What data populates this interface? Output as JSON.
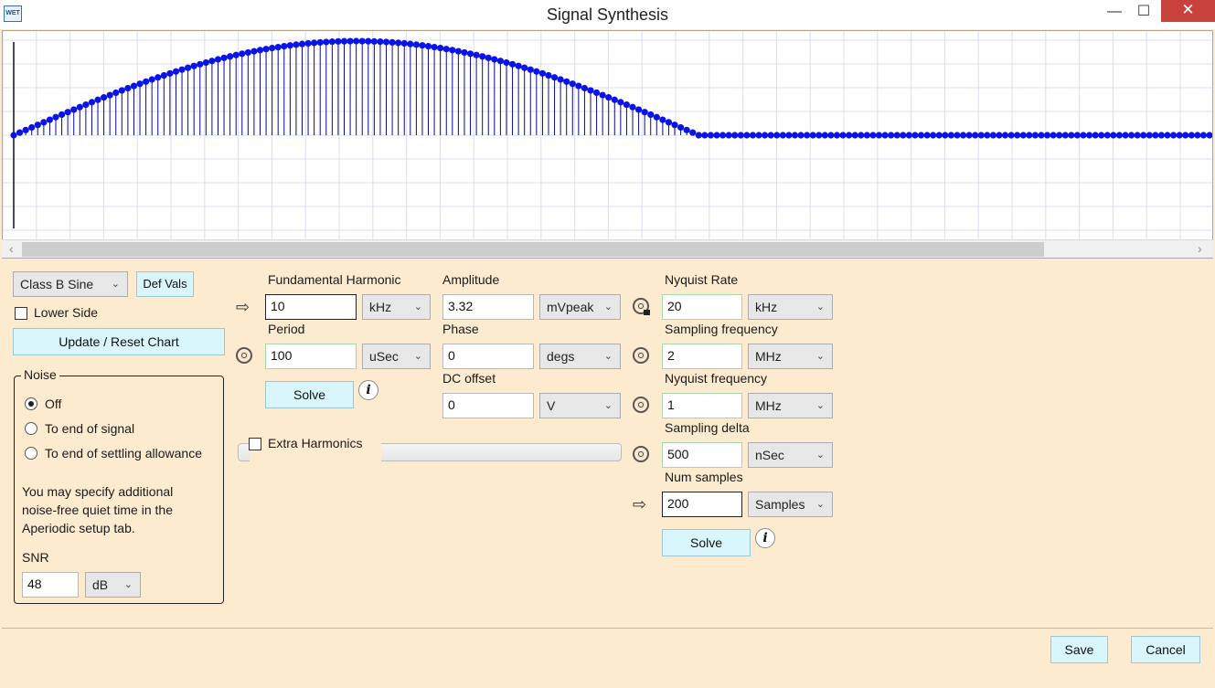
{
  "window": {
    "title": "Signal Synthesis",
    "app_icon_text": "WET"
  },
  "chart_data": {
    "type": "stem",
    "num_samples": 200,
    "description_values": "half-sine (Class B) lobe over first 114 samples then zero",
    "lobe_samples": 114,
    "amplitude": 1,
    "series": [
      {
        "values": "generated: samples 0..113 = sin(pi*n/114), samples 114..199 = 0"
      }
    ],
    "grid": true,
    "marker_color": "#0a14e8",
    "stem_color": "#0a0a8a"
  },
  "waveform": {
    "selected": "Class B Sine",
    "def_vals_label": "Def Vals",
    "lower_side_label": "Lower Side",
    "update_label": "Update / Reset Chart"
  },
  "noise": {
    "group_title": "Noise",
    "options": [
      "Off",
      "To end of signal",
      "To end of settling allowance"
    ],
    "selected_index": 0,
    "note_lines": [
      "You may specify additional",
      "noise-free quiet time in the",
      "Aperiodic setup tab."
    ],
    "snr_label": "SNR",
    "snr_value": "48",
    "snr_unit": "dB"
  },
  "fundamental": {
    "label": "Fundamental Harmonic",
    "value": "10",
    "unit": "kHz",
    "period_label": "Period",
    "period_value": "100",
    "period_unit": "uSec",
    "solve_label": "Solve"
  },
  "amplitude": {
    "label": "Amplitude",
    "value": "3.32",
    "unit": "mVpeak"
  },
  "phase": {
    "label": "Phase",
    "value": "0",
    "unit": "degs"
  },
  "dc_offset": {
    "label": "DC offset",
    "value": "0",
    "unit": "V"
  },
  "extra_harmonics": {
    "label": "Extra Harmonics"
  },
  "sampling": {
    "nyquist_rate_label": "Nyquist Rate",
    "nyquist_rate_value": "20",
    "nyquist_rate_unit": "kHz",
    "sampling_freq_label": "Sampling frequency",
    "sampling_freq_value": "2",
    "sampling_freq_unit": "MHz",
    "nyquist_freq_label": "Nyquist frequency",
    "nyquist_freq_value": "1",
    "nyquist_freq_unit": "MHz",
    "sampling_delta_label": "Sampling delta",
    "sampling_delta_value": "500",
    "sampling_delta_unit": "nSec",
    "num_samples_label": "Num samples",
    "num_samples_value": "200",
    "num_samples_unit": "Samples",
    "solve_label": "Solve"
  },
  "footer": {
    "save_label": "Save",
    "cancel_label": "Cancel"
  },
  "icons": {
    "info": "i",
    "arrow": "⇨",
    "chevron": "⌵"
  }
}
